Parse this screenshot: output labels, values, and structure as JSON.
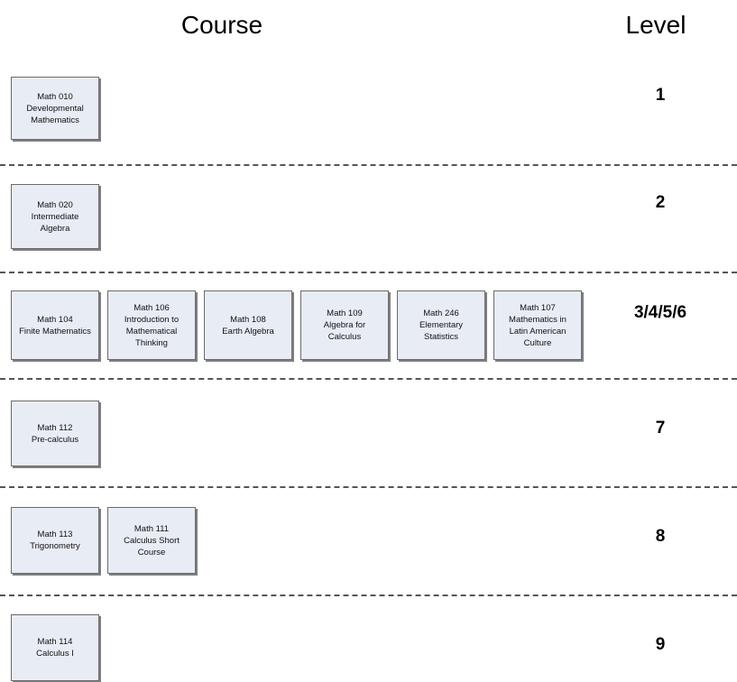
{
  "headers": {
    "course": "Course",
    "level": "Level"
  },
  "rows": [
    {
      "level": "1",
      "courses": [
        {
          "code": "Math 010",
          "title": "Developmental\nMathematics"
        }
      ]
    },
    {
      "level": "2",
      "courses": [
        {
          "code": "Math 020",
          "title": "Intermediate\nAlgebra"
        }
      ]
    },
    {
      "level": "3/4/5/6",
      "courses": [
        {
          "code": "Math 104",
          "title": "Finite Mathematics"
        },
        {
          "code": "Math 106",
          "title": "Introduction to\nMathematical\nThinking"
        },
        {
          "code": "Math 108",
          "title": "Earth Algebra"
        },
        {
          "code": "Math 109",
          "title": "Algebra  for\nCalculus"
        },
        {
          "code": "Math 246",
          "title": "Elementary\nStatistics"
        },
        {
          "code": "Math 107",
          "title": "Mathematics in\nLatin American\nCulture"
        }
      ]
    },
    {
      "level": "7",
      "courses": [
        {
          "code": "Math 112",
          "title": "Pre-calculus"
        }
      ]
    },
    {
      "level": "8",
      "courses": [
        {
          "code": "Math 113",
          "title": "Trigonometry"
        },
        {
          "code": "Math 111",
          "title": "Calculus Short\nCourse"
        }
      ]
    },
    {
      "level": "9",
      "courses": [
        {
          "code": "Math 114",
          "title": "Calculus I"
        }
      ]
    }
  ],
  "style": {
    "box_fill": "#e8ecf5",
    "box_border": "#6b6b6b",
    "divider_color": "#555555",
    "text_color": "#000000"
  }
}
